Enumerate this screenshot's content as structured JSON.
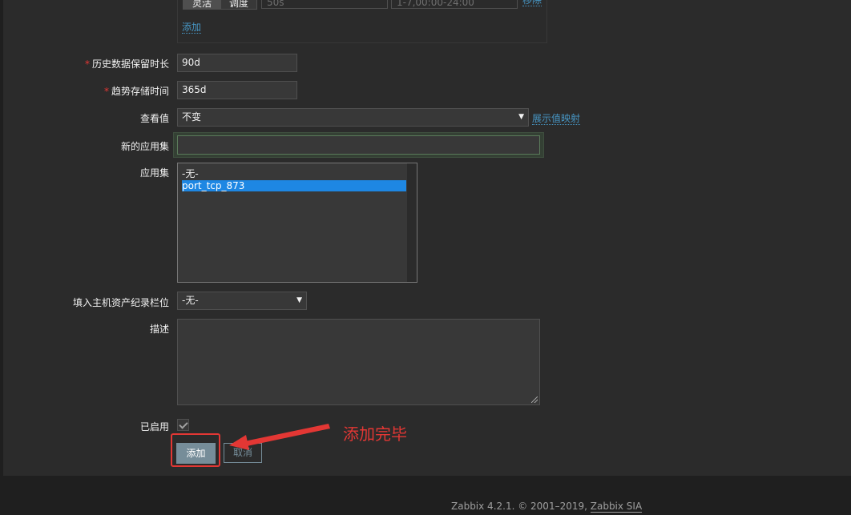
{
  "interval": {
    "segments": [
      "灵活",
      "调度"
    ],
    "interval_value": "50s",
    "period_value": "1-7,00:00-24:00",
    "remove_label": "移除",
    "add_label": "添加"
  },
  "fields": {
    "history_label": "历史数据保留时长",
    "history_value": "90d",
    "trends_label": "趋势存储时间",
    "trends_value": "365d",
    "show_value_label": "查看值",
    "show_value_selected": "不变",
    "show_value_mapping_link": "展示值映射",
    "new_application_label": "新的应用集",
    "new_application_value": "",
    "applications_label": "应用集",
    "applications_options": [
      "-无-",
      "port_tcp_873"
    ],
    "inventory_label": "填入主机资产纪录栏位",
    "inventory_selected": "-无-",
    "description_label": "描述",
    "description_value": "",
    "enabled_label": "已启用",
    "enabled": true
  },
  "buttons": {
    "add": "添加",
    "cancel": "取消"
  },
  "annotation": {
    "text": "添加完毕",
    "color": "#e33734"
  },
  "footer": {
    "text": "Zabbix 4.2.1. © 2001–2019, ",
    "link": "Zabbix SIA"
  },
  "colors": {
    "background": "#2b2b2b",
    "link": "#4796c4",
    "primary_button": "#768d99",
    "selection": "#1e87e3",
    "required": "#e33734"
  }
}
